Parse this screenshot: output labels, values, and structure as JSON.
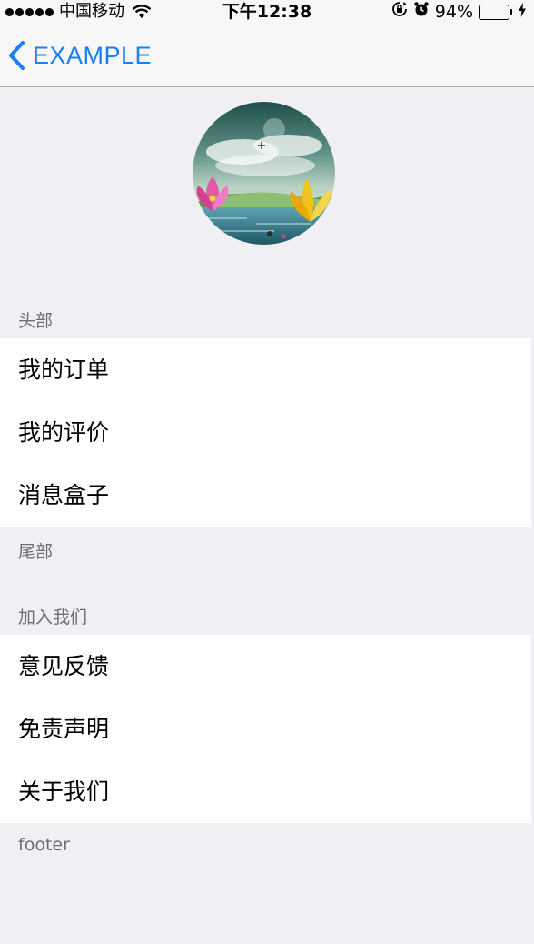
{
  "status_bar": {
    "carrier": "中国移动",
    "time": "下午12:38",
    "battery_percent": "94%",
    "battery_level": 0.94,
    "battery_color": "#4cd964"
  },
  "nav": {
    "back_label": "EXAMPLE",
    "tint_color": "#1a7ef5"
  },
  "sections": [
    {
      "header": "头部",
      "items": [
        {
          "label": "我的订单"
        },
        {
          "label": "我的评价"
        },
        {
          "label": "消息盒子"
        }
      ],
      "footer": "尾部"
    },
    {
      "header": "加入我们",
      "items": [
        {
          "label": "意见反馈"
        },
        {
          "label": "免责声明"
        },
        {
          "label": "关于我们"
        }
      ],
      "footer": "footer"
    }
  ]
}
